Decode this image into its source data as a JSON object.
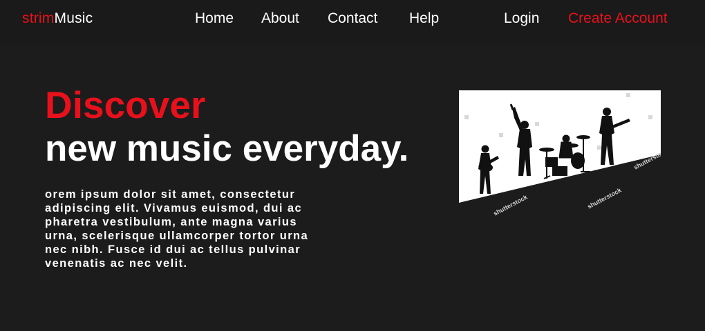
{
  "brand": {
    "accent": "strim",
    "rest": "Music",
    "accent_color": "#e8111b"
  },
  "nav": {
    "home": "Home",
    "about": "About",
    "contact": "Contact",
    "help": "Help",
    "login": "Login",
    "create_account": "Create Account"
  },
  "hero": {
    "headline_accent": "Discover",
    "headline_main": "new music everyday.",
    "body": "orem ipsum dolor sit amet, consectetur adipiscing elit. Vivamus euismod, dui ac pharetra vestibulum, ante magna varius urna, scelerisque ullamcorper tortor urna nec nibh. Fusce id dui ac tellus pulvinar venenatis ac nec velit.",
    "image": {
      "icon": "band-silhouette-image",
      "watermark": "shutterstock"
    }
  },
  "colors": {
    "background": "#1c1c1d",
    "navbar": "#1a1a1a",
    "accent": "#e8111b",
    "text": "#ffffff"
  }
}
